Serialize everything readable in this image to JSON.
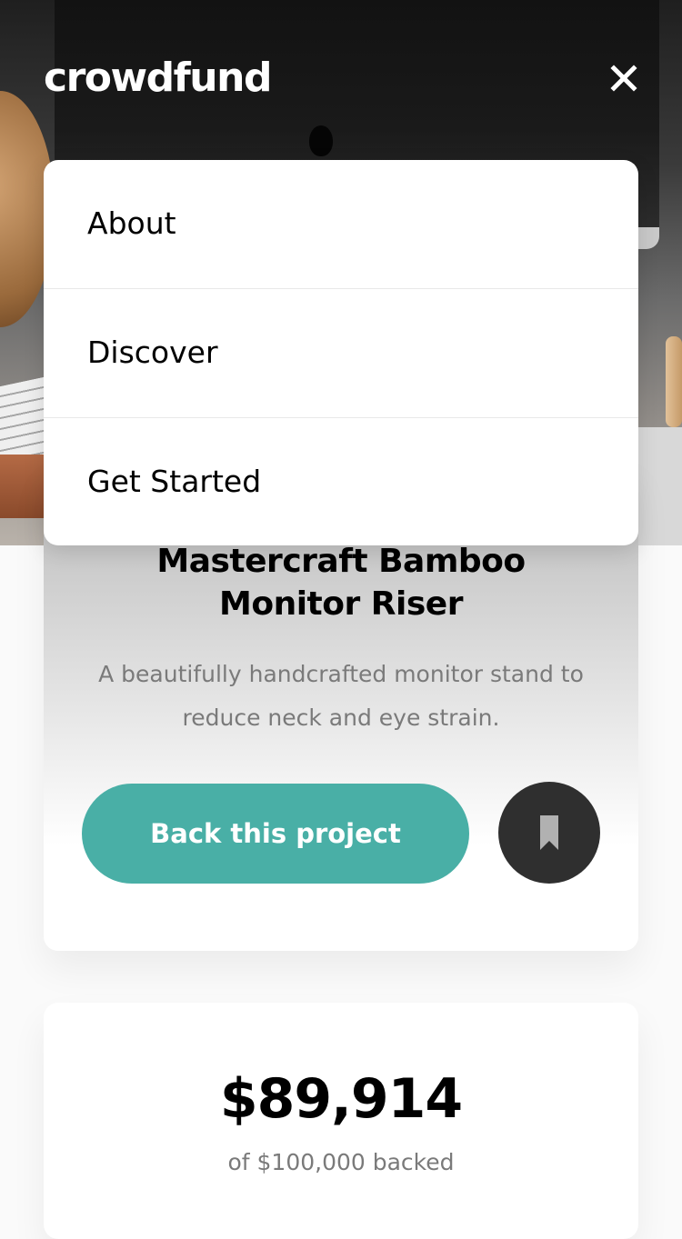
{
  "header": {
    "logo": "crowdfund",
    "close_icon": "close-icon"
  },
  "menu": {
    "items": [
      {
        "label": "About"
      },
      {
        "label": "Discover"
      },
      {
        "label": "Get Started"
      }
    ]
  },
  "project": {
    "title_line1": "Mastercraft Bamboo",
    "title_line2": "Monitor Riser",
    "description": "A beautifully handcrafted monitor stand to reduce neck and eye strain.",
    "back_button_label": "Back this project",
    "bookmark_icon": "bookmark-icon"
  },
  "stats": {
    "amount_backed": "$89,914",
    "goal_text": "of $100,000 backed"
  },
  "colors": {
    "accent": "#49afa6",
    "dark_button": "#2f2f2f",
    "muted_text": "#7a7a7a"
  }
}
